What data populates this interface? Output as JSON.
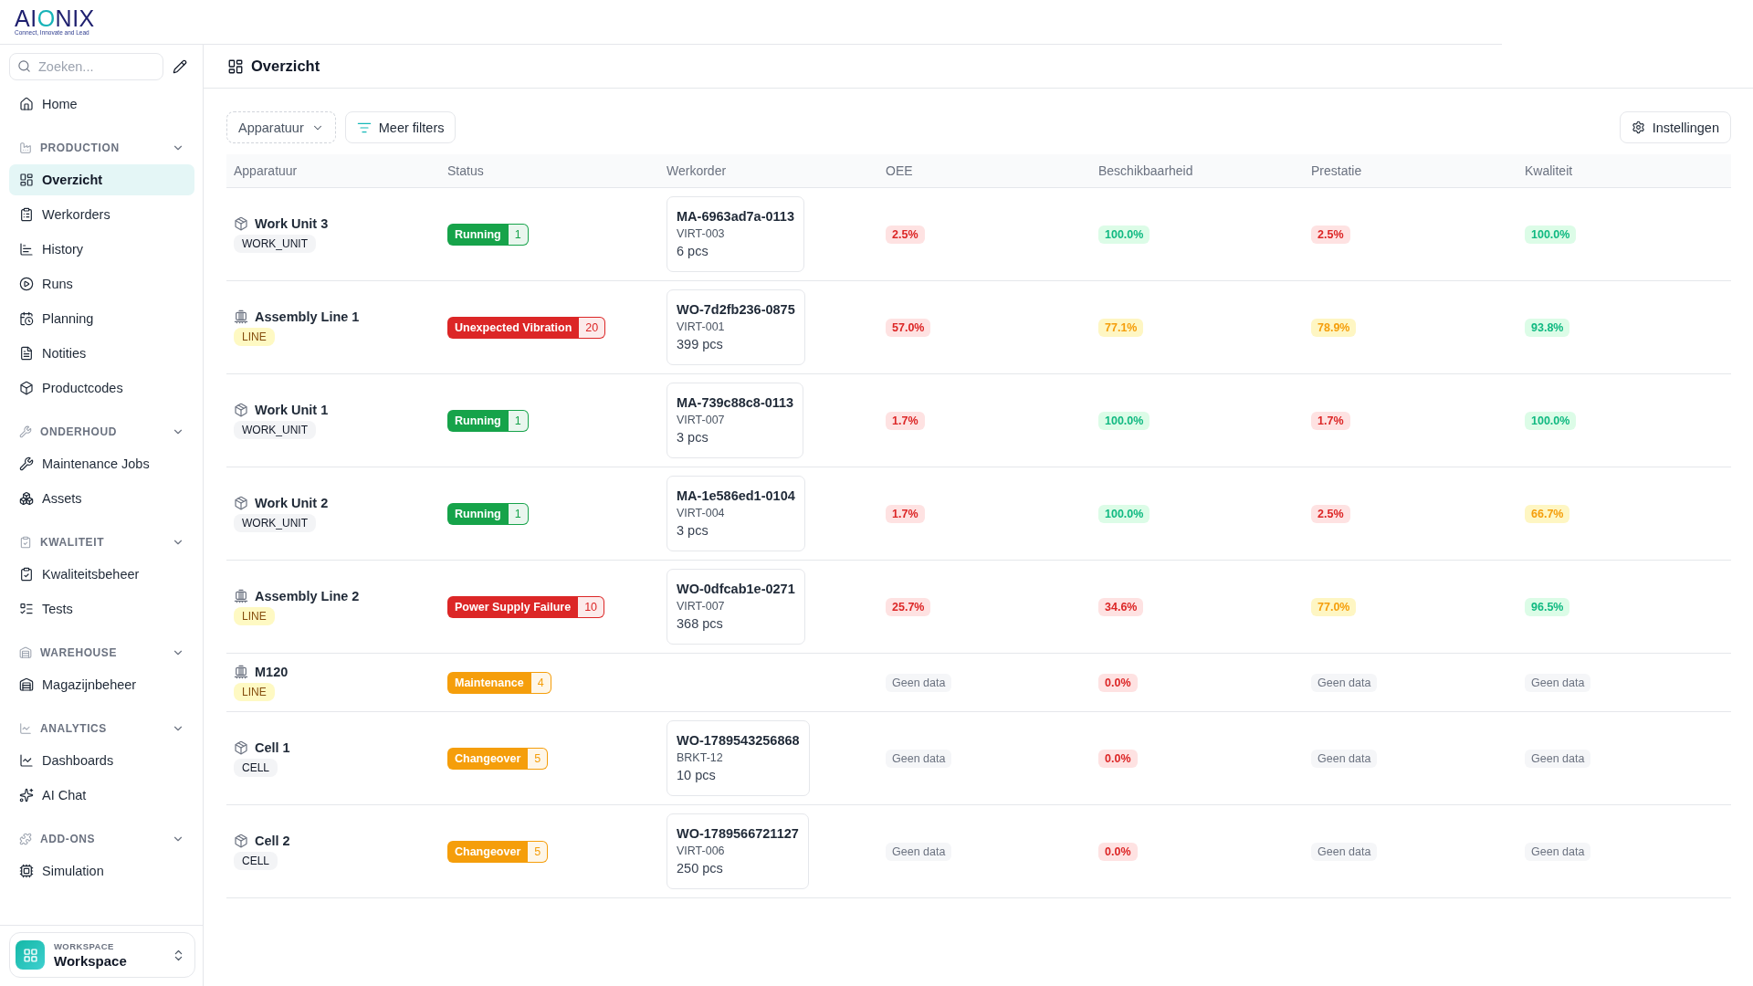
{
  "logo": {
    "wordmark": [
      {
        "text": "AI",
        "accent": false
      },
      {
        "text": "O",
        "accent": true
      },
      {
        "text": "NIX",
        "accent": false
      }
    ],
    "tagline": "Connect, Innovate and Lead"
  },
  "sidebar": {
    "search": {
      "placeholder": "Zoeken..."
    },
    "top_items": [
      {
        "label": "Home",
        "selected": false
      }
    ],
    "sections": [
      {
        "title": "PRODUCTION",
        "expanded": true,
        "items": [
          {
            "label": "Overzicht",
            "selected": true
          },
          {
            "label": "Werkorders",
            "selected": false
          },
          {
            "label": "History",
            "selected": false
          },
          {
            "label": "Runs",
            "selected": false
          },
          {
            "label": "Planning",
            "selected": false
          },
          {
            "label": "Notities",
            "selected": false
          },
          {
            "label": "Productcodes",
            "selected": false
          }
        ]
      },
      {
        "title": "ONDERHOUD",
        "expanded": true,
        "items": [
          {
            "label": "Maintenance Jobs",
            "selected": false
          },
          {
            "label": "Assets",
            "selected": false
          }
        ]
      },
      {
        "title": "KWALITEIT",
        "expanded": true,
        "items": [
          {
            "label": "Kwaliteitsbeheer",
            "selected": false
          },
          {
            "label": "Tests",
            "selected": false
          }
        ]
      },
      {
        "title": "WAREHOUSE",
        "expanded": true,
        "items": [
          {
            "label": "Magazijnbeheer",
            "selected": false
          }
        ]
      },
      {
        "title": "ANALYTICS",
        "expanded": true,
        "items": [
          {
            "label": "Dashboards",
            "selected": false
          },
          {
            "label": "AI Chat",
            "selected": false
          }
        ]
      },
      {
        "title": "ADD-ONS",
        "expanded": true,
        "items": [
          {
            "label": "Simulation",
            "selected": false
          }
        ]
      }
    ],
    "workspace": {
      "caption": "WORKSPACE",
      "name": "Workspace"
    }
  },
  "page": {
    "title": "Overzicht"
  },
  "toolbar": {
    "equipment_filter": {
      "label": "Apparatuur"
    },
    "more_filters": {
      "label": "Meer filters"
    },
    "settings": {
      "label": "Instellingen"
    }
  },
  "table": {
    "columns": [
      "Apparatuur",
      "Status",
      "Werkorder",
      "OEE",
      "Beschikbaarheid",
      "Prestatie",
      "Kwaliteit"
    ],
    "rows": [
      {
        "equipment": {
          "name": "Work Unit 3",
          "type": "WORK_UNIT",
          "kind": "unit"
        },
        "status": {
          "label": "Running",
          "count": "1",
          "color": "#16a34a"
        },
        "work_order": {
          "id": "MA-6963ad7a-0113",
          "product": "VIRT-003",
          "quantity": "6 pcs"
        },
        "metrics": [
          {
            "value": "2.5%",
            "color": "#dc2626"
          },
          {
            "value": "100.0%",
            "color": "#10b981"
          },
          {
            "value": "2.5%",
            "color": "#dc2626"
          },
          {
            "value": "100.0%",
            "color": "#10b981"
          }
        ]
      },
      {
        "equipment": {
          "name": "Assembly Line 1",
          "type": "LINE",
          "kind": "line"
        },
        "status": {
          "label": "Unexpected Vibration",
          "count": "20",
          "color": "#dc2626"
        },
        "work_order": {
          "id": "WO-7d2fb236-0875",
          "product": "VIRT-001",
          "quantity": "399 pcs"
        },
        "metrics": [
          {
            "value": "57.0%",
            "color": "#dc2626"
          },
          {
            "value": "77.1%",
            "color": "#f59e0b"
          },
          {
            "value": "78.9%",
            "color": "#f59e0b"
          },
          {
            "value": "93.8%",
            "color": "#10b981"
          }
        ]
      },
      {
        "equipment": {
          "name": "Work Unit 1",
          "type": "WORK_UNIT",
          "kind": "unit"
        },
        "status": {
          "label": "Running",
          "count": "1",
          "color": "#16a34a"
        },
        "work_order": {
          "id": "MA-739c88c8-0113",
          "product": "VIRT-007",
          "quantity": "3 pcs"
        },
        "metrics": [
          {
            "value": "1.7%",
            "color": "#dc2626"
          },
          {
            "value": "100.0%",
            "color": "#10b981"
          },
          {
            "value": "1.7%",
            "color": "#dc2626"
          },
          {
            "value": "100.0%",
            "color": "#10b981"
          }
        ]
      },
      {
        "equipment": {
          "name": "Work Unit 2",
          "type": "WORK_UNIT",
          "kind": "unit"
        },
        "status": {
          "label": "Running",
          "count": "1",
          "color": "#16a34a"
        },
        "work_order": {
          "id": "MA-1e586ed1-0104",
          "product": "VIRT-004",
          "quantity": "3 pcs"
        },
        "metrics": [
          {
            "value": "1.7%",
            "color": "#dc2626"
          },
          {
            "value": "100.0%",
            "color": "#10b981"
          },
          {
            "value": "2.5%",
            "color": "#dc2626"
          },
          {
            "value": "66.7%",
            "color": "#f59e0b"
          }
        ]
      },
      {
        "equipment": {
          "name": "Assembly Line 2",
          "type": "LINE",
          "kind": "line"
        },
        "status": {
          "label": "Power Supply Failure",
          "count": "10",
          "color": "#dc2626"
        },
        "work_order": {
          "id": "WO-0dfcab1e-0271",
          "product": "VIRT-007",
          "quantity": "368 pcs"
        },
        "metrics": [
          {
            "value": "25.7%",
            "color": "#dc2626"
          },
          {
            "value": "34.6%",
            "color": "#dc2626"
          },
          {
            "value": "77.0%",
            "color": "#f59e0b"
          },
          {
            "value": "96.5%",
            "color": "#10b981"
          }
        ]
      },
      {
        "equipment": {
          "name": "M120",
          "type": "LINE",
          "kind": "line"
        },
        "status": {
          "label": "Maintenance",
          "count": "4",
          "color": "#f59e0b"
        },
        "metrics": [
          {
            "value": "Geen data",
            "color": "#6b7280"
          },
          {
            "value": "0.0%",
            "color": "#dc2626"
          },
          {
            "value": "Geen data",
            "color": "#6b7280"
          },
          {
            "value": "Geen data",
            "color": "#6b7280"
          }
        ]
      },
      {
        "equipment": {
          "name": "Cell 1",
          "type": "CELL",
          "kind": "unit"
        },
        "status": {
          "label": "Changeover",
          "count": "5",
          "color": "#f59e0b"
        },
        "work_order": {
          "id": "WO-1789543256868",
          "product": "BRKT-12",
          "quantity": "10 pcs"
        },
        "metrics": [
          {
            "value": "Geen data",
            "color": "#6b7280"
          },
          {
            "value": "0.0%",
            "color": "#dc2626"
          },
          {
            "value": "Geen data",
            "color": "#6b7280"
          },
          {
            "value": "Geen data",
            "color": "#6b7280"
          }
        ]
      },
      {
        "equipment": {
          "name": "Cell 2",
          "type": "CELL",
          "kind": "unit"
        },
        "status": {
          "label": "Changeover",
          "count": "5",
          "color": "#f59e0b"
        },
        "work_order": {
          "id": "WO-1789566721127",
          "product": "VIRT-006",
          "quantity": "250 pcs"
        },
        "metrics": [
          {
            "value": "Geen data",
            "color": "#6b7280"
          },
          {
            "value": "0.0%",
            "color": "#dc2626"
          },
          {
            "value": "Geen data",
            "color": "#6b7280"
          },
          {
            "value": "Geen data",
            "color": "#6b7280"
          }
        ]
      }
    ]
  }
}
